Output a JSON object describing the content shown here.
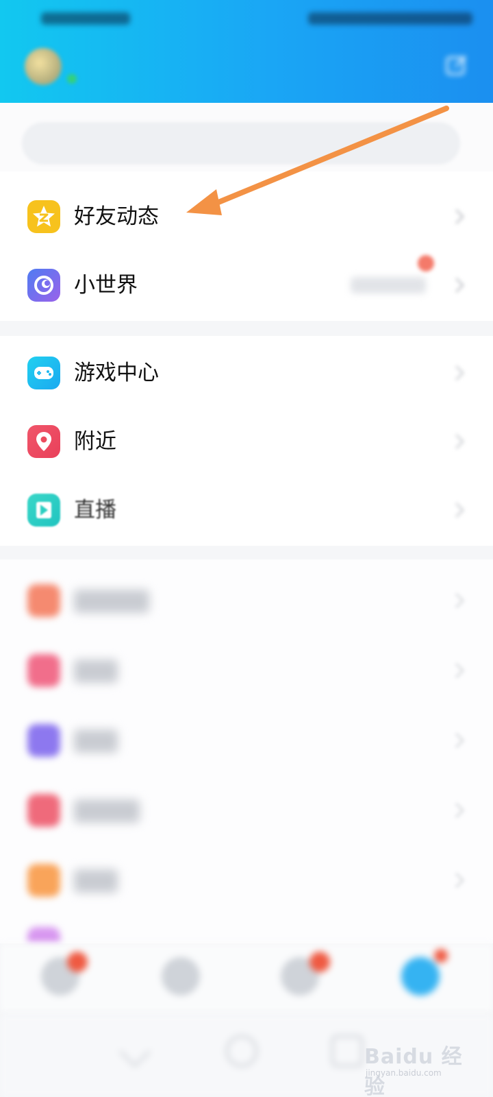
{
  "header": {
    "title": "",
    "accent_color": "#1aa6f5"
  },
  "search": {
    "placeholder": ""
  },
  "groups": [
    {
      "items": [
        {
          "label": "好友动态",
          "icon": "qzone-star-icon",
          "color": "#f7c21d",
          "blurred": false
        },
        {
          "label": "小世界",
          "icon": "planet-icon",
          "color": "#6b6ff1",
          "blurred": false,
          "has_badge": true
        }
      ]
    },
    {
      "items": [
        {
          "label": "游戏中心",
          "icon": "gamepad-icon",
          "color": "#22c6ef",
          "blurred": false
        },
        {
          "label": "附近",
          "icon": "location-pin-icon",
          "color": "#ec4c5e",
          "blurred": false
        },
        {
          "label": "直播",
          "icon": "live-icon",
          "color": "#2ccfc2",
          "blurred": false
        }
      ]
    },
    {
      "items": [
        {
          "label": "",
          "icon": "app-icon-orange",
          "color": "#f58a70",
          "blurred": true
        },
        {
          "label": "",
          "icon": "app-icon-pink",
          "color": "#f16e8b",
          "blurred": true
        },
        {
          "label": "",
          "icon": "app-icon-purple",
          "color": "#8d78ef",
          "blurred": true
        },
        {
          "label": "",
          "icon": "app-icon-red",
          "color": "#ef6a7b",
          "blurred": true
        },
        {
          "label": "",
          "icon": "app-icon-amber",
          "color": "#f9a45a",
          "blurred": true
        }
      ]
    }
  ],
  "annotation": {
    "arrow_color": "#f39245"
  },
  "watermark": {
    "brand": "Baidu 经验",
    "url": "jingyan.baidu.com"
  }
}
